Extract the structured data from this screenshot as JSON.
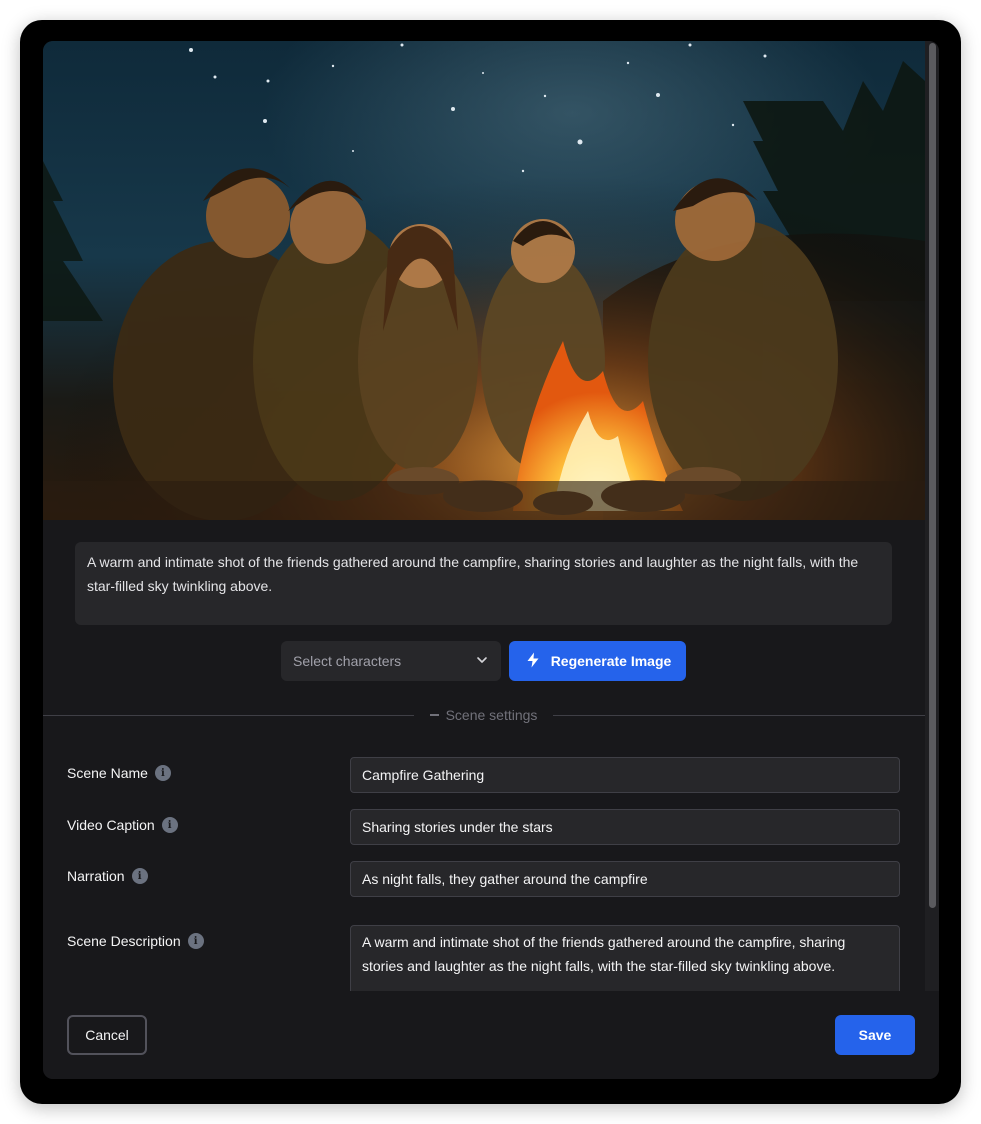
{
  "scene_image": {
    "prompt": "A warm and intimate shot of the friends gathered around the campfire, sharing stories and laughter as the night falls, with the star-filled sky twinkling above."
  },
  "character_select": {
    "placeholder": "Select characters",
    "icon": "chevron-down-icon"
  },
  "regenerate_button": {
    "label": "Regenerate Image",
    "icon": "lightning-bolt-icon"
  },
  "section_divider": {
    "label": "Scene settings"
  },
  "fields": {
    "scene_name": {
      "label": "Scene Name",
      "value": "Campfire Gathering"
    },
    "video_caption": {
      "label": "Video Caption",
      "value": "Sharing stories under the stars"
    },
    "narration": {
      "label": "Narration",
      "value": "As night falls, they gather around the campfire"
    },
    "scene_description": {
      "label": "Scene Description",
      "value": "A warm and intimate shot of the friends gathered around the campfire, sharing stories and laughter as the night falls, with the star-filled sky twinkling above."
    }
  },
  "footer": {
    "cancel_label": "Cancel",
    "save_label": "Save"
  },
  "colors": {
    "accent": "#2563eb",
    "panel_bg": "#18181b",
    "input_bg": "#27272a"
  }
}
